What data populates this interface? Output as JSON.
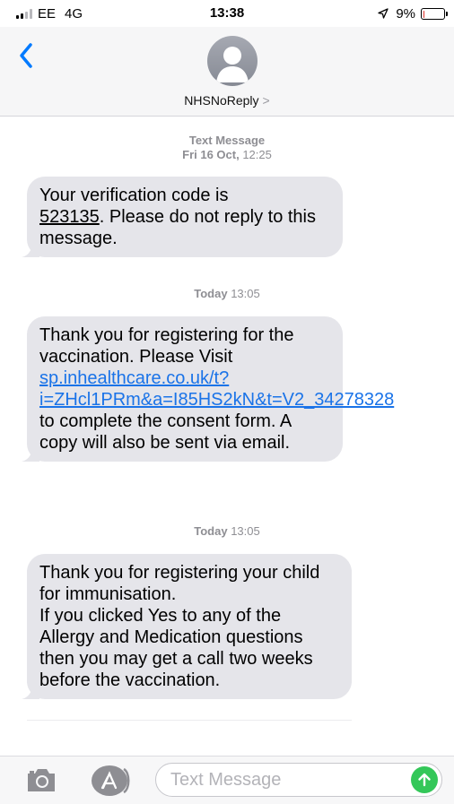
{
  "status_bar": {
    "carrier": "EE",
    "network": "4G",
    "time": "13:38",
    "battery_percent": "9%",
    "battery_level": 0.09,
    "battery_color": "#e0332c"
  },
  "header": {
    "back_icon": "chevron-left-icon",
    "avatar_icon": "person-icon",
    "contact_name": "NHSNoReply",
    "contact_chevron": ">"
  },
  "thread": {
    "ts1": {
      "line1": "Text Message",
      "line2_bold": "Fri 16 Oct,",
      "line2_rest": " 12:25"
    },
    "msg1": {
      "pre": "Your verification code is",
      "code": "523135",
      "post": ". Please do not reply to this message."
    },
    "ts2": {
      "bold": "Today",
      "rest": " 13:05"
    },
    "msg2": {
      "pre": "Thank you for registering for the vaccination. Please Visit ",
      "link": "sp.inhealthcare.co.uk/t?i=ZHcl1PRm&a=I85HS2kN&t=V2_34278328",
      "post": " to complete the consent form. A copy will also be sent via email."
    },
    "ts3": {
      "bold": "Today",
      "rest": " 13:05"
    },
    "msg3": {
      "line1": "Thank you for registering your child for immunisation.",
      "line2": "If you clicked Yes to any of the Allergy and Medication questions then you may get a call two weeks before the vaccination."
    }
  },
  "compose": {
    "camera_icon": "camera-icon",
    "apps_icon": "app-store-icon",
    "placeholder": "Text Message",
    "send_icon": "arrow-up-icon",
    "send_color": "#34c759"
  },
  "colors": {
    "accent": "#007aff",
    "bubble_bg": "#e5e5ea",
    "link": "#1a73e8"
  }
}
